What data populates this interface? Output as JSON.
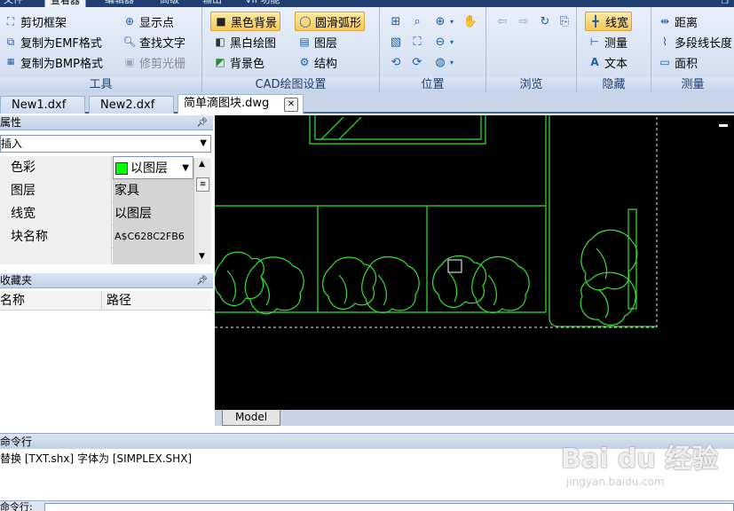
{
  "menu": {
    "tabs": [
      "文件",
      "查看器",
      "编辑器",
      "高级",
      "输出",
      "VIP功能"
    ],
    "active_index": 1
  },
  "ribbon": {
    "tools": {
      "label": "工具",
      "items": [
        "剪切框架",
        "复制为EMF格式",
        "复制为BMP格式",
        "显示点",
        "查找文字",
        "修剪光栅"
      ]
    },
    "cad_settings": {
      "label": "CAD绘图设置",
      "items": [
        "黑色背景",
        "黑白绘图",
        "背景色",
        "圆滑弧形",
        "图层",
        "结构"
      ]
    },
    "position": {
      "label": "位置"
    },
    "browse": {
      "label": "浏览"
    },
    "hide": {
      "label": "隐藏",
      "items": [
        "线宽",
        "测量",
        "文本"
      ]
    },
    "measure": {
      "label": "测量",
      "items": [
        "距离",
        "多段线长度",
        "面积"
      ]
    }
  },
  "doc_tabs": [
    "New1.dxf",
    "New2.dxf",
    "简单滴图块.dwg"
  ],
  "properties": {
    "title": "属性",
    "selection": "插入",
    "rows": [
      {
        "name": "色彩",
        "value": "以图层"
      },
      {
        "name": "图层",
        "value": "家具"
      },
      {
        "name": "线宽",
        "value": "以图层"
      },
      {
        "name": "块名称",
        "value": "A$C628C2FB6"
      }
    ],
    "swatch_color": "#00ff00"
  },
  "favorites": {
    "title": "收藏夹",
    "columns": [
      "名称",
      "路径"
    ]
  },
  "canvas": {
    "model_tab": "Model",
    "background": "#000000",
    "line_color": "#35e035"
  },
  "command": {
    "title": "命令行",
    "output": "替换 [TXT.shx] 字体为 [SIMPLEX.SHX]",
    "prompt": "命令行:"
  },
  "watermark": {
    "main": "Bai du 经验",
    "sub": "jingyan.baidu.com"
  }
}
